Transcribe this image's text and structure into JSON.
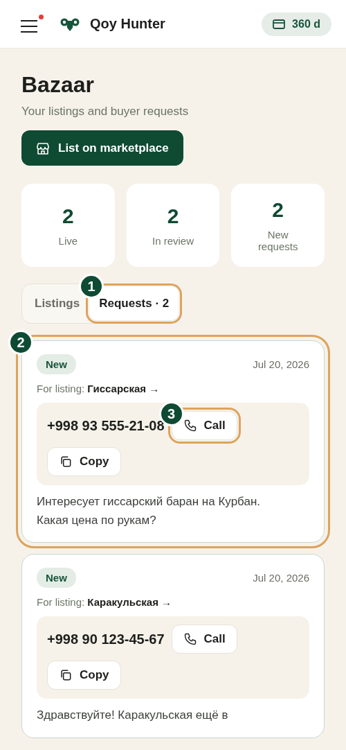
{
  "header": {
    "menu_badge": true,
    "brand": "Qoy Hunter",
    "balance": "360 d"
  },
  "page": {
    "title": "Bazaar",
    "subtitle": "Your listings and buyer requests",
    "primary_action": "List on marketplace"
  },
  "stats": [
    {
      "value": "2",
      "label": "Live"
    },
    {
      "value": "2",
      "label": "In review"
    },
    {
      "value": "2",
      "label": "New requests"
    }
  ],
  "tabs": [
    {
      "label": "Listings",
      "selected": false
    },
    {
      "label": "Requests · 2",
      "selected": true,
      "callout": "1"
    }
  ],
  "requests": [
    {
      "status": "New",
      "date": "Jul 20, 2026",
      "listing_prefix": "For listing:",
      "listing": "Гиссарская →",
      "phone": "+998 93 555-21-08",
      "call": "Call",
      "copy": "Copy",
      "message": "Интересует гиссарский баран на Курбан. Какая цена по рукам?",
      "callout": "2",
      "call_callout": "3"
    },
    {
      "status": "New",
      "date": "Jul 20, 2026",
      "listing_prefix": "For listing:",
      "listing": "Каракульская →",
      "phone": "+998 90 123-45-67",
      "call": "Call",
      "copy": "Copy",
      "message": "Здравствуйте! Каракульская ещё в"
    }
  ]
}
